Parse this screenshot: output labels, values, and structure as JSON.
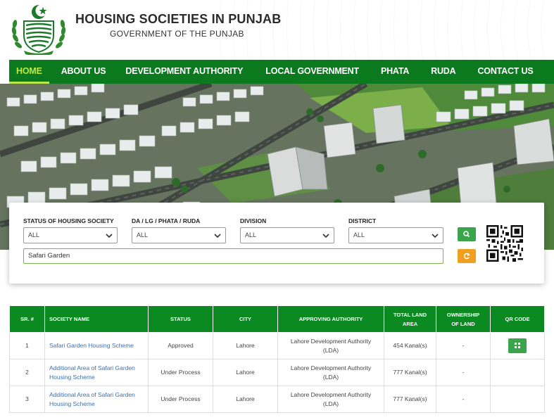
{
  "header": {
    "title": "HOUSING SOCIETIES IN PUNJAB",
    "subtitle": "GOVERNMENT OF THE PUNJAB"
  },
  "nav": {
    "items": [
      "HOME",
      "ABOUT US",
      "DEVELOPMENT AUTHORITY",
      "LOCAL GOVERNMENT",
      "PHATA",
      "RUDA",
      "CONTACT US"
    ]
  },
  "filters": {
    "status": {
      "label": "STATUS OF HOUSING SOCIETY",
      "value": "ALL"
    },
    "authority": {
      "label": "DA / LG / PHATA / RUDA",
      "value": "ALL"
    },
    "division": {
      "label": "DIVISION",
      "value": "ALL"
    },
    "district": {
      "label": "DISTRICT",
      "value": "ALL"
    },
    "search_value": "Safari Garden"
  },
  "table": {
    "headers": {
      "sr": "SR. #",
      "name": "SOCIETY NAME",
      "status": "STATUS",
      "city": "CITY",
      "authority": "APPROVING AUTHORITY",
      "area_1": "TOTAL LAND",
      "area_2": "AREA",
      "ownership_1": "OWNERSHIP",
      "ownership_2": "OF LAND",
      "qr": "QR CODE"
    },
    "rows": [
      {
        "sr": "1",
        "name_1": "Safari Garden Housing Scheme",
        "name_2": "",
        "status": "Approved",
        "city": "Lahore",
        "authority_1": "Lahore Development Authority",
        "authority_2": "(LDA)",
        "area": "454 Kanal(s)",
        "ownership": "-"
      },
      {
        "sr": "2",
        "name_1": "Additional Area of Safari Garden",
        "name_2": "Housing Scheme",
        "status": "Under Process",
        "city": "Lahore",
        "authority_1": "Lahore Development Authority",
        "authority_2": "(LDA)",
        "area": "777 Kanal(s)",
        "ownership": "-"
      },
      {
        "sr": "3",
        "name_1": "Additional Area of Safari Garden",
        "name_2": "Housing Scheme",
        "status": "Under Process",
        "city": "Lahore",
        "authority_1": "Lahore Development Authority",
        "authority_2": "(LDA)",
        "area": "777 Kanal(s)",
        "ownership": "-"
      }
    ]
  },
  "colors": {
    "nav_bg": "#0b7a1f",
    "nav_active": "#b9e84a",
    "table_header": "#0b8a21",
    "search_button": "#3aa54a",
    "reset_button": "#f0a020",
    "link": "#3b6fb0"
  },
  "icons": {
    "logo": "punjab-government-emblem",
    "search": "search-icon",
    "reset": "refresh-icon",
    "qr": "qr-code-icon"
  }
}
